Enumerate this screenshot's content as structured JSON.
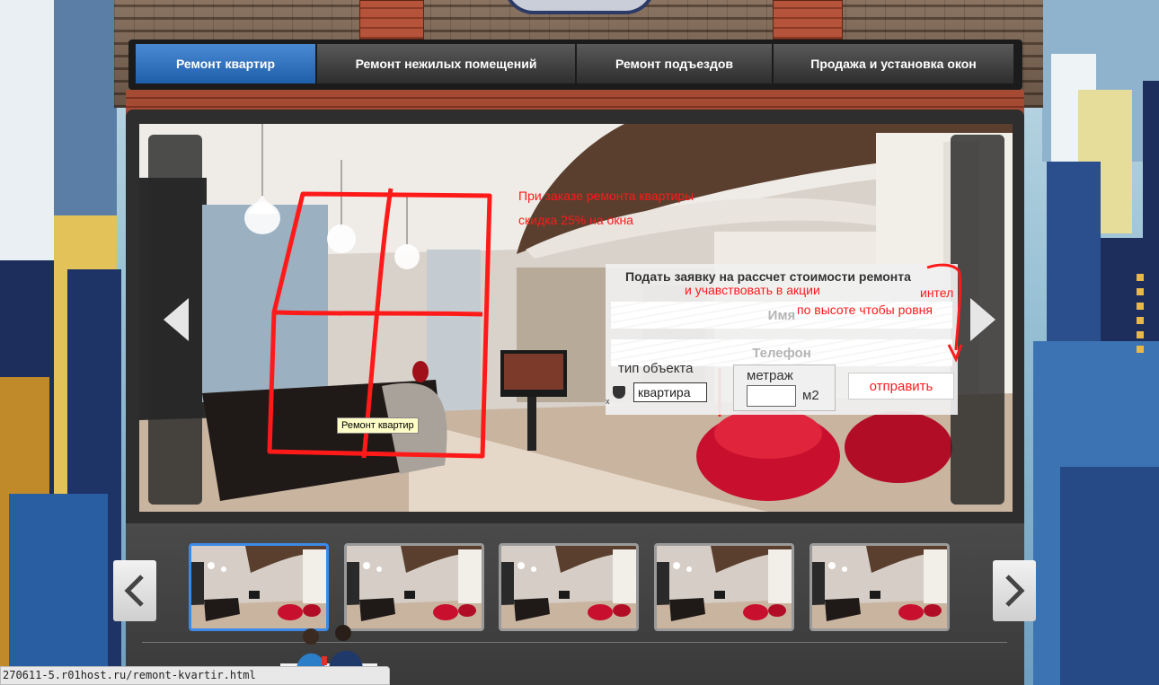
{
  "nav": {
    "tabs": [
      {
        "label": "Ремонт квартир",
        "active": true
      },
      {
        "label": "Ремонт нежилых помещений",
        "active": false
      },
      {
        "label": "Ремонт подъездов",
        "active": false
      },
      {
        "label": "Продажа и установка окон",
        "active": false
      }
    ]
  },
  "slide": {
    "promo_line1": "При заказе ремонта квартиры",
    "promo_line2": "скидка 25% на окна",
    "tooltip": "Ремонт квартир"
  },
  "form": {
    "title": "Подать заявку на рассчет стоимости ремонта",
    "note_subtitle": "и учавствовать в акции",
    "note_right1": "интел",
    "note_right2": "по высоте чтобы ровня",
    "name_placeholder": "Имя",
    "phone_placeholder": "Телефон",
    "type_label": "тип объекта",
    "type_value": "квартира",
    "meter_label": "метраж",
    "meter_unit": "м2",
    "submit_label": "отправить",
    "stray_mark": "x"
  },
  "thumbnails": {
    "count": 5,
    "active_index": 0
  },
  "status_bar": {
    "url": "270611-5.r01host.ru/remont-kvartir.html"
  },
  "colors": {
    "accent_blue": "#2a6cbf",
    "annotation_red": "#ff1a1a"
  },
  "icons": [
    "chevron-left-icon",
    "chevron-right-icon",
    "shield-icon"
  ]
}
